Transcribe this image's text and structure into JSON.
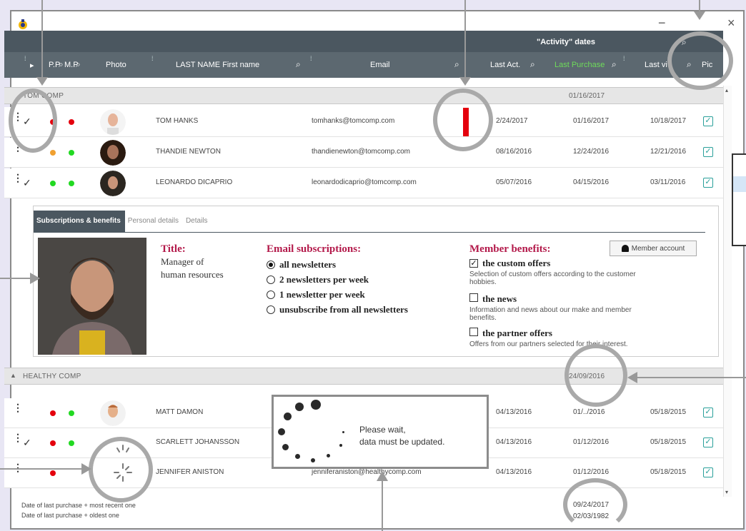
{
  "window": {
    "minimize": "−",
    "close": "×"
  },
  "header": {
    "activity_title": "\"Activity\" dates",
    "columns": {
      "pp": "P.P",
      "mp": "M.P",
      "photo": "Photo",
      "name": "LAST NAME First name",
      "email": "Email",
      "last_act": "Last Act.",
      "last_purchase": "Last Purchase",
      "last_visit": "Last vi",
      "pick": "Pic"
    },
    "last_purchase_color": "#6fdc5a"
  },
  "groups": [
    {
      "name": "TOM COMP",
      "date": "01/16/2017"
    },
    {
      "name": "HEALTHY COMP",
      "date": "24/09/2016"
    }
  ],
  "rows_tom": [
    {
      "name": "TOM HANKS",
      "email": "tomhanks@tomcomp.com",
      "last_act": "2/24/2017",
      "last_purchase": "01/16/2017",
      "last_visit": "10/18/2017"
    },
    {
      "name": "THANDIE NEWTON",
      "email": "thandienewton@tomcomp.com",
      "last_act": "08/16/2016",
      "last_purchase": "12/24/2016",
      "last_visit": "12/21/2016"
    },
    {
      "name": "LEONARDO DICAPRIO",
      "email": "leonardodicaprio@tomcomp.com",
      "last_act": "05/07/2016",
      "last_purchase": "04/15/2016",
      "last_visit": "03/11/2016"
    }
  ],
  "rows_healthy": [
    {
      "name": "MATT DAMON",
      "email": "",
      "last_act": "04/13/2016",
      "last_purchase": "01/../2016",
      "last_visit": "05/18/2015"
    },
    {
      "name": "SCARLETT JOHANSSON",
      "email": "",
      "last_act": "04/13/2016",
      "last_purchase": "01/12/2016",
      "last_visit": "05/18/2015"
    },
    {
      "name": "JENNIFER ANISTON",
      "email": "jenniferaniston@healthycomp.com",
      "last_act": "04/13/2016",
      "last_purchase": "01/12/2016",
      "last_visit": "05/18/2015"
    }
  ],
  "detail": {
    "tabs": [
      "Subscriptions & benefits",
      "Personal details",
      "Details"
    ],
    "title_label": "Title:",
    "title_value_1": "Manager of",
    "title_value_2": "human resources",
    "email_sub_label": "Email subscriptions:",
    "email_options": [
      "all newsletters",
      "2 newsletters per week",
      "1 newsletter per week",
      "unsubscribe from all newsletters"
    ],
    "email_selected": 0,
    "benefits_label": "Member benefits:",
    "benefits": [
      {
        "title": "the custom offers",
        "checked": true,
        "desc_1": "Selection of custom offers according to the customer",
        "desc_2": "hobbies."
      },
      {
        "title": "the news",
        "checked": false,
        "desc_1": "Information and news about our make and member",
        "desc_2": "benefits."
      },
      {
        "title": "the partner offers",
        "checked": false,
        "desc_1": "Offers from our partners selected for their interest.",
        "desc_2": ""
      }
    ],
    "member_account": "Member account"
  },
  "footer": {
    "recent_label": "Date of last purchase + most recent one",
    "oldest_label": "Date of last purchase + oldest one",
    "recent_date": "09/24/2017",
    "oldest_date": "02/03/1982"
  },
  "overlay": {
    "line1": "Please wait,",
    "line2": "data must be updated."
  },
  "colors": {
    "header_dark": "#4b5760",
    "header": "#5c6870",
    "accent_red": "#b3194a",
    "check_teal": "#2aa09a",
    "flag_red": "#e4000d"
  }
}
